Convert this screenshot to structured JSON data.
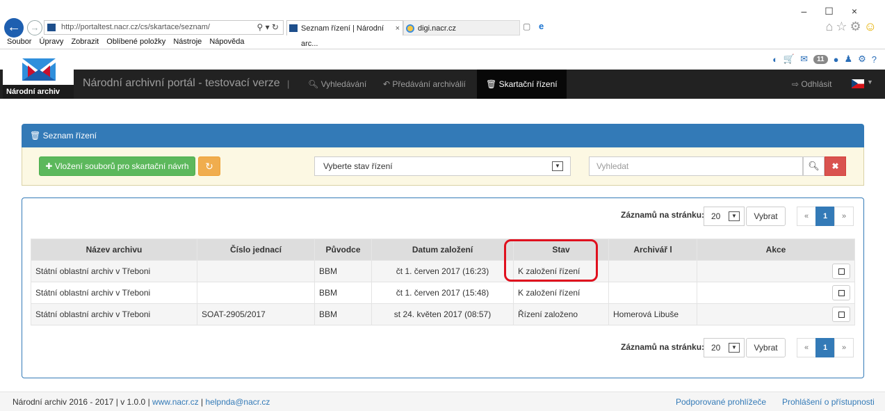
{
  "browser": {
    "url": "http://portaltest.nacr.cz/cs/skartace/seznam/",
    "tabs": [
      {
        "label": "Seznam řízení | Národní arc...",
        "close": "×"
      },
      {
        "label": "digi.nacr.cz"
      }
    ],
    "menu": [
      "Soubor",
      "Úpravy",
      "Zobrazit",
      "Oblíbené položky",
      "Nástroje",
      "Nápověda"
    ],
    "window_controls": "–☐×"
  },
  "app": {
    "logo_text": "Národní archiv",
    "brand": "Národní archivní portál - testovací verze",
    "separator": "|",
    "nav": {
      "search": "Vyhledávání",
      "transfer": "Předávání archiválií",
      "shredding": "Skartační řízení",
      "logout": "Odhlásit"
    },
    "messages_badge": "11"
  },
  "panel": {
    "title": "Seznam řízení",
    "add_button": "Vložení souborů pro skartační návrh",
    "state_select": "Vyberte stav řízení",
    "search_placeholder": "Vyhledat"
  },
  "paging": {
    "label": "Záznamů na stránku:",
    "per_page": "20",
    "choose_button": "Vybrat",
    "prev": "«",
    "current": "1",
    "next": "»"
  },
  "table": {
    "headers": [
      "Název archivu",
      "Číslo jednací",
      "Původce",
      "Datum založení",
      "Stav",
      "Archivář l",
      "Akce"
    ],
    "rows": [
      [
        "Státní oblastní archiv v Třeboni",
        "",
        "BBM",
        "čt 1. červen 2017 (16:23)",
        "K založení řízení",
        ""
      ],
      [
        "Státní oblastní archiv v Třeboni",
        "",
        "BBM",
        "čt 1. červen 2017 (15:48)",
        "K založení řízení",
        ""
      ],
      [
        "Státní oblastní archiv v Třeboni",
        "SOAT-2905/2017",
        "BBM",
        "st 24. květen 2017 (08:57)",
        "Řízení založeno",
        "Homerová Libuše"
      ]
    ]
  },
  "footer": {
    "copyright": "Národní archiv 2016 - 2017 | v 1.0.0 | ",
    "site": "www.nacr.cz",
    "pipe": " | ",
    "email": "helpnda@nacr.cz",
    "browsers": "Podporované prohlížeče",
    "accessibility": "Prohlášení o přístupnosti"
  },
  "colors": {
    "primary": "#337ab7",
    "success": "#5cb85c",
    "warning": "#f0ad4e",
    "danger": "#d9534f",
    "navbar": "#222222",
    "highlight": "#e0101e"
  }
}
